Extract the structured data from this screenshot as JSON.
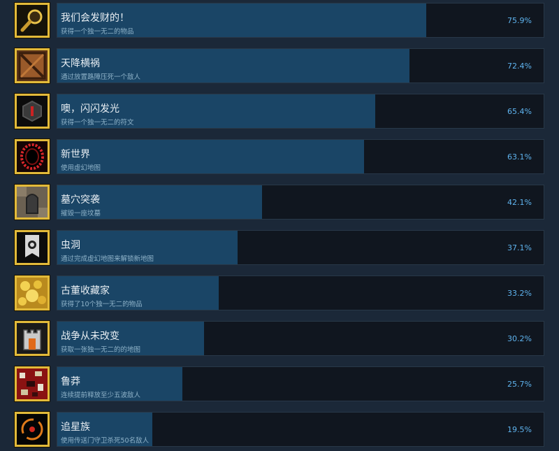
{
  "achievements": [
    {
      "title": "我们会发财的！",
      "description": "获得一个独一无二的物品",
      "percent_label": "75.9%",
      "percent": 75.9,
      "icon": "magnifier-icon"
    },
    {
      "title": "天降横祸",
      "description": "通过放置路障压死一个敌人",
      "percent_label": "72.4%",
      "percent": 72.4,
      "icon": "crate-icon"
    },
    {
      "title": "噢，闪闪发光",
      "description": "获得一个独一无二的符文",
      "percent_label": "65.4%",
      "percent": 65.4,
      "icon": "rune-icon"
    },
    {
      "title": "新世界",
      "description": "使用虚幻地图",
      "percent_label": "63.1%",
      "percent": 63.1,
      "icon": "portal-icon"
    },
    {
      "title": "墓穴突袭",
      "description": "摧毁一座坟墓",
      "percent_label": "42.1%",
      "percent": 42.1,
      "icon": "tomb-icon"
    },
    {
      "title": "虫洞",
      "description": "通过完成虚幻地图来解锁新地图",
      "percent_label": "37.1%",
      "percent": 37.1,
      "icon": "banner-icon"
    },
    {
      "title": "古董收藏家",
      "description": "获得了10个独一无二的物品",
      "percent_label": "33.2%",
      "percent": 33.2,
      "icon": "treasure-icon"
    },
    {
      "title": "战争从未改变",
      "description": "获取一张独一无二的的地图",
      "percent_label": "30.2%",
      "percent": 30.2,
      "icon": "tower-icon"
    },
    {
      "title": "鲁莽",
      "description": "连续提前释放至少五波敌人",
      "percent_label": "25.7%",
      "percent": 25.7,
      "icon": "chaos-icon"
    },
    {
      "title": "追星族",
      "description": "使用传送门守卫杀死50名敌人",
      "percent_label": "19.5%",
      "percent": 19.5,
      "icon": "orbit-icon"
    }
  ],
  "colors": {
    "frame": "#e2ba3a",
    "bar_fill": "#1a4566",
    "bar_bg": "#10161f",
    "percent_text": "#5fb4ef"
  }
}
